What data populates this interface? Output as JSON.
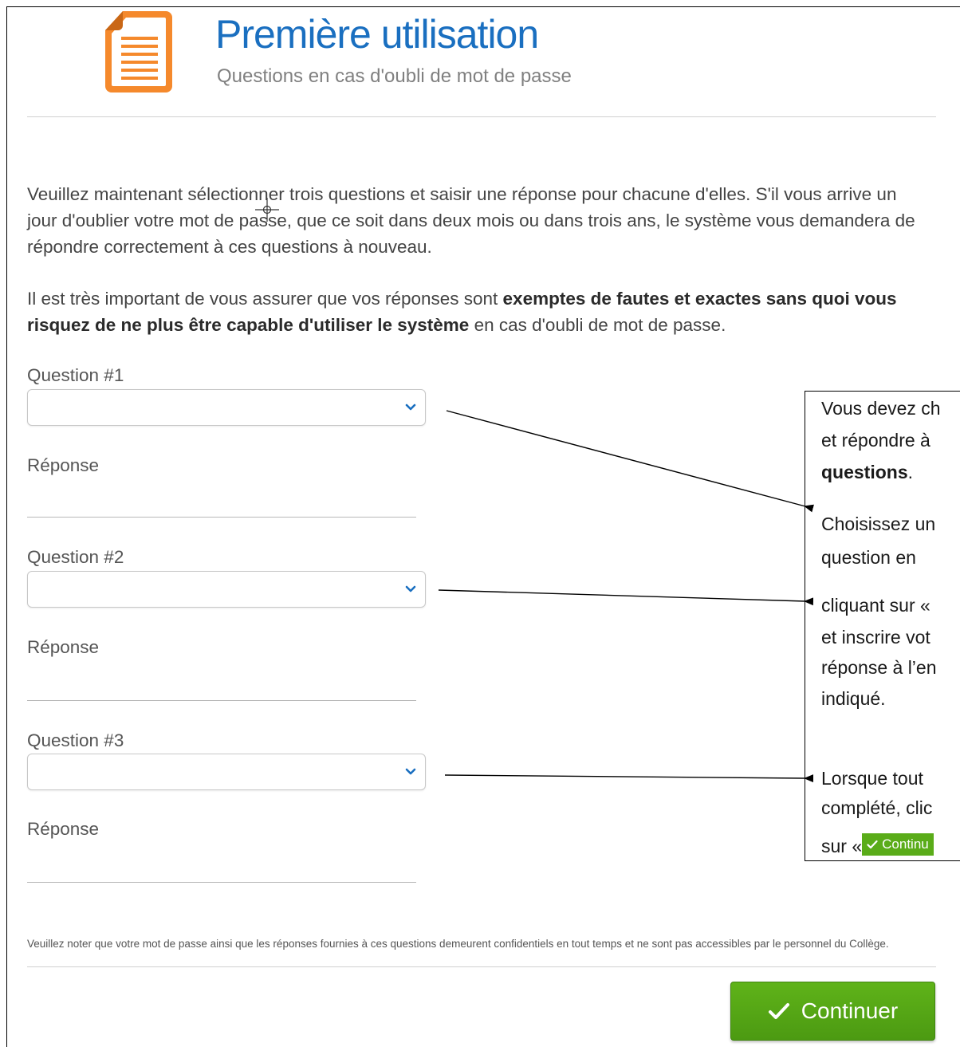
{
  "header": {
    "title": "Première utilisation",
    "subtitle": "Questions en cas d'oubli de mot de passe"
  },
  "intro": {
    "paragraph1": "Veuillez maintenant sélectionner trois questions et saisir une réponse pour chacune d'elles. S'il vous arrive un jour d'oublier votre mot de passe, que ce soit dans deux mois ou dans trois ans, le système vous demandera de répondre correctement à ces questions à nouveau.",
    "paragraph2_start": "Il est très important de vous assurer que vos réponses sont ",
    "paragraph2_bold": "exemptes de fautes et exactes sans quoi vous risquez de ne plus être capable d'utiliser le système",
    "paragraph2_end": " en cas d'oubli de mot de passe."
  },
  "questions": [
    {
      "label": "Question #1",
      "selected": "",
      "answer_label": "Réponse",
      "answer_value": ""
    },
    {
      "label": "Question #2",
      "selected": "",
      "answer_label": "Réponse",
      "answer_value": ""
    },
    {
      "label": "Question #3",
      "selected": "",
      "answer_label": "Réponse",
      "answer_value": ""
    }
  ],
  "footer_note": "Veuillez noter que votre mot de passe ainsi que les réponses fournies à ces questions demeurent confidentiels en tout temps et ne sont pas accessibles par le personnel du Collège.",
  "continue_label": "Continuer",
  "callout": {
    "lines": [
      "Vous devez ch",
      "et répondre à",
      "questions",
      ".",
      "Choisissez un",
      "question en",
      "cliquant sur «",
      "et inscrire vot",
      "réponse à l’en",
      "indiqué.",
      "Lorsque tout",
      "complété, clic",
      "sur «"
    ],
    "mini_button_label": "Continu"
  },
  "icons": {
    "document": "document-icon",
    "chevron": "chevron-down-icon",
    "check": "check-icon",
    "cursor": "move-cursor-icon"
  },
  "colors": {
    "title": "#1a6fc0",
    "icon_orange": "#f5892c",
    "button_green": "#5aac19"
  }
}
